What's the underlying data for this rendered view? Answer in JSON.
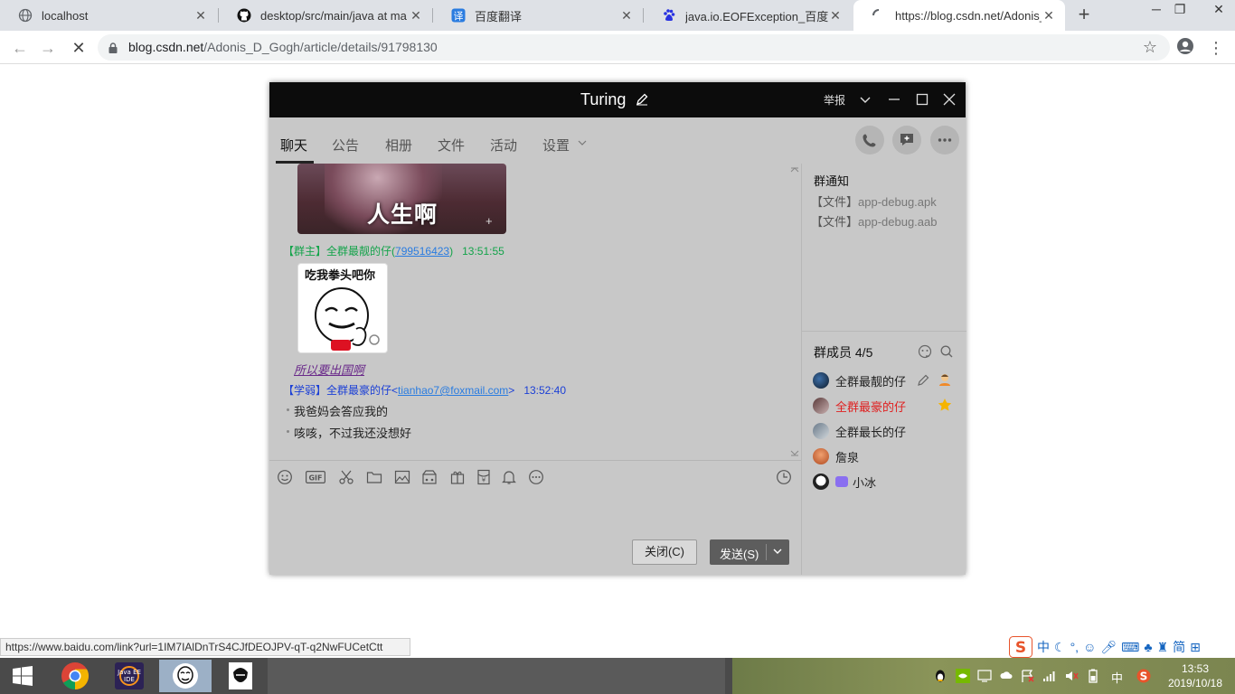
{
  "browser": {
    "tabs": [
      {
        "title": "localhost",
        "icon": "globe-icon"
      },
      {
        "title": "desktop/src/main/java at ma",
        "icon": "github-icon"
      },
      {
        "title": "百度翻译",
        "icon": "baidu-translate-icon"
      },
      {
        "title": "java.io.EOFException_百度搜索",
        "icon": "baidu-paw-icon"
      },
      {
        "title": "https://blog.csdn.net/Adonis_",
        "icon": "loading-spinner-icon"
      }
    ],
    "url_domain": "blog.csdn.net",
    "url_path": "/Adonis_D_Gogh/article/details/91798130",
    "status_url": "https://www.baidu.com/link?url=1IM7IAlDnTrS4CJfDEOJPV-qT-q2NwFUCetCtt"
  },
  "qq": {
    "title": "Turing",
    "report": "举报",
    "nav": {
      "tabs": [
        "聊天",
        "公告",
        "相册",
        "文件",
        "活动",
        "设置"
      ]
    },
    "messages": {
      "img1_text": "人生啊",
      "msg2": {
        "tag": "【群主】",
        "name": "全群最靓的仔",
        "qq": "799516423",
        "time": "13:51:55"
      },
      "sticker_text": "吃我拳头吧你",
      "caption": "所以要出国啊",
      "msg3": {
        "tag": "【学弱】",
        "name": "全群最豪的仔",
        "email": "tianhao7@foxmail.com",
        "time": "13:52:40"
      },
      "lines": [
        "我爸妈会答应我的",
        "咳咳，不过我还没想好"
      ]
    },
    "buttons": {
      "close": "关闭(C)",
      "send": "发送(S)"
    },
    "side": {
      "notice_title": "群通知",
      "files": [
        {
          "tag": "【文件】",
          "name": "app-debug.apk"
        },
        {
          "tag": "【文件】",
          "name": "app-debug.aab"
        }
      ],
      "members_title": "群成员 4/5",
      "members": [
        {
          "name": "全群最靓的仔",
          "color": "#222222"
        },
        {
          "name": "全群最豪的仔",
          "color": "#e02020"
        },
        {
          "name": "全群最长的仔",
          "color": "#222222"
        },
        {
          "name": "詹泉",
          "color": "#222222"
        },
        {
          "name": "小冰",
          "color": "#222222"
        }
      ]
    }
  },
  "taskbar": {
    "time": "13:53",
    "date": "2019/10/18",
    "ime_lang": "中",
    "ime_items": [
      "中",
      "简"
    ]
  },
  "colors": {
    "owner_green": "#13a34a",
    "member_blue": "#1b3fd6",
    "link_blue": "#2a7ce0",
    "title_black": "#0c0c0c"
  }
}
